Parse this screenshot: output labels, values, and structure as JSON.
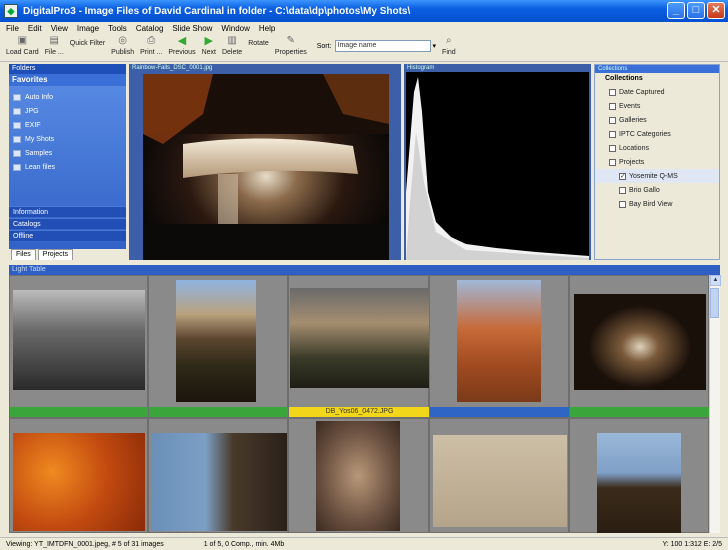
{
  "window": {
    "title": "DigitalPro3 - Image Files of David Cardinal in folder - C:\\data\\dp\\photos\\My Shots\\"
  },
  "menu": [
    "File",
    "Edit",
    "View",
    "Image",
    "Tools",
    "Catalog",
    "Slide Show",
    "Window",
    "Help"
  ],
  "toolbar": {
    "items": [
      {
        "label": "Load Card",
        "icon": "camera-icon"
      },
      {
        "label": "File ...",
        "icon": "save-icon"
      },
      {
        "label": "Quick Filter",
        "icon": "filter-icon"
      },
      {
        "label": "Publish",
        "icon": "globe-icon"
      },
      {
        "label": "Print ...",
        "icon": "print-icon"
      },
      {
        "label": "Previous",
        "icon": "arrow-left-icon"
      },
      {
        "label": "Next",
        "icon": "arrow-right-icon"
      },
      {
        "label": "Delete",
        "icon": "delete-icon"
      },
      {
        "label": "Rotate",
        "icon": "rotate-icon"
      },
      {
        "label": "Properties",
        "icon": "properties-icon"
      },
      {
        "label": "Find",
        "icon": "search-icon"
      }
    ],
    "sort_label": "Sort:",
    "sort_value": "Image name"
  },
  "left_panel": {
    "header": "Folders",
    "section": "Favorites",
    "folders": [
      "Auto Info",
      "JPG",
      "EXIF",
      "My Shots",
      "Samples",
      "Lean files"
    ],
    "bottom_sections": [
      "Information",
      "Catalogs",
      "Offline"
    ],
    "tabs": [
      "Files",
      "Projects"
    ]
  },
  "preview": {
    "header": "Rainbow-Falls_DSC_0001.jpg"
  },
  "histogram": {
    "header": "Histogram"
  },
  "collections": {
    "header": "Collections",
    "title": "Collections",
    "items": [
      {
        "label": "Date Captured",
        "level": 0,
        "checked": false
      },
      {
        "label": "Events",
        "level": 0,
        "checked": false
      },
      {
        "label": "Galleries",
        "level": 0,
        "checked": false
      },
      {
        "label": "IPTC Categories",
        "level": 0,
        "checked": false
      },
      {
        "label": "Locations",
        "level": 0,
        "checked": false
      },
      {
        "label": "Projects",
        "level": 0,
        "checked": false
      },
      {
        "label": "Yosemite Q-MS",
        "level": 1,
        "checked": true
      },
      {
        "label": "Brio Gallo",
        "level": 1,
        "checked": false
      },
      {
        "label": "Bay Bird View",
        "level": 1,
        "checked": false
      }
    ]
  },
  "light_table": {
    "header": "Light Table"
  },
  "thumbnails": {
    "row1": [
      {
        "caption": "",
        "caption_color": "#3aa53a"
      },
      {
        "caption": "",
        "caption_color": "#3aa53a"
      },
      {
        "caption": "DB_Yos06_0472.JPG",
        "caption_color": "#f2d619"
      },
      {
        "caption": "",
        "caption_color": "#2f66c6"
      },
      {
        "caption": "",
        "caption_color": "#3aa53a"
      }
    ]
  },
  "status": {
    "left": "Viewing: YT_IMTDFN_0001.jpeg, # 5 of 31 images",
    "mid": "1 of 5, 0 Comp., min. 4Mb",
    "right": "Y: 100 1:312 E: 2/5"
  }
}
